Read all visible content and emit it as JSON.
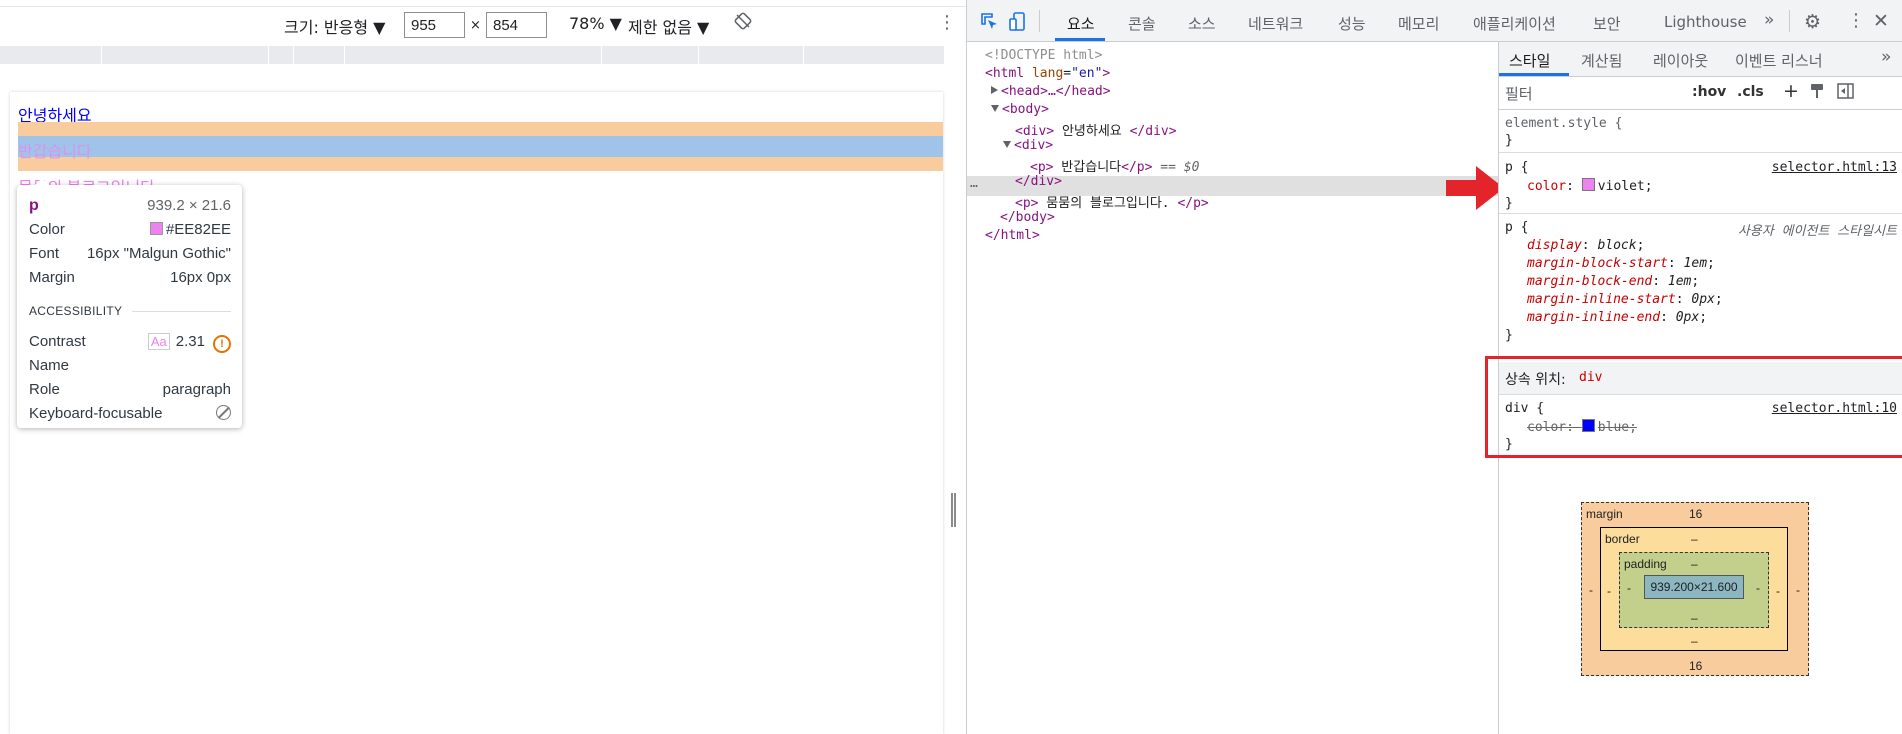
{
  "device_toolbar": {
    "dimensions_label": "크기: 반응형 ▼",
    "width": "955",
    "times": "×",
    "height": "854",
    "zoom": "78% ▼",
    "throttle": "제한 없음 ▼",
    "rotate_icon": "rotate-icon",
    "more_icon": "more-vert-icon"
  },
  "page": {
    "line1": "안녕하세요",
    "line2": "반갑습니다",
    "line3": "뭄뭄의 블로그입니다"
  },
  "tooltip": {
    "tag": "p",
    "size": "939.2 × 21.6",
    "color_label": "Color",
    "color_value": "#EE82EE",
    "font_label": "Font",
    "font_value": "16px \"Malgun Gothic\"",
    "margin_label": "Margin",
    "margin_value": "16px 0px",
    "accessibility_title": "ACCESSIBILITY",
    "contrast_label": "Contrast",
    "contrast_aa": "Aa",
    "contrast_value": "2.31",
    "name_label": "Name",
    "role_label": "Role",
    "role_value": "paragraph",
    "keyboard_label": "Keyboard-focusable"
  },
  "devtools_tabs": [
    "요소",
    "콘솔",
    "소스",
    "네트워크",
    "성능",
    "메모리",
    "애플리케이션",
    "보안",
    "Lighthouse"
  ],
  "devtools_more": "»",
  "dom": {
    "doctype": "<!DOCTYPE html>",
    "html_open_tag": "<html",
    "html_attr": "lang",
    "html_attr_value": "\"en\"",
    "html_open_end": ">",
    "head": "<head>…</head>",
    "body_open": "<body>",
    "div1_open": "<div>",
    "div1_text": " 안녕하세요 ",
    "div1_close": "</div>",
    "div2_open": "<div>",
    "p_open": "<p>",
    "p_text": " 반갑습니다",
    "p_close": "</p>",
    "p_eq": " == $0",
    "div2_close": "</div>",
    "p2_open": "<p>",
    "p2_text": " 뭄뭄의 블로그입니다. ",
    "p2_close": "</p>",
    "body_close": "</body>",
    "html_close": "</html>",
    "dots": "…"
  },
  "styles_pane": {
    "tabs": [
      "스타일",
      "계산됨",
      "레이아웃",
      "이벤트 리스너"
    ],
    "more": "»",
    "filter_placeholder": "필터",
    "hov": ":hov",
    "cls": ".cls",
    "plus": "+",
    "element_style_open": "element.style {",
    "close_brace": "}",
    "p_rule_selector": "p {",
    "p_rule_source": "selector.html:13",
    "p_rule_prop": "color",
    "p_rule_value": "violet",
    "ua_selector": "p {",
    "ua_source": "사용자 에이전트 스타일시트",
    "ua_props": [
      {
        "name": "display",
        "value": "block"
      },
      {
        "name": "margin-block-start",
        "value": "1em"
      },
      {
        "name": "margin-block-end",
        "value": "1em"
      },
      {
        "name": "margin-inline-start",
        "value": "0px"
      },
      {
        "name": "margin-inline-end",
        "value": "0px"
      }
    ],
    "inherit_label": "상속 위치:",
    "inherit_from": "div",
    "div_rule_selector": "div {",
    "div_rule_source": "selector.html:10",
    "div_rule_prop": "color",
    "div_rule_value": "blue"
  },
  "box_model": {
    "margin_label": "margin",
    "margin_top": "16",
    "margin_bottom": "16",
    "margin_left": "-",
    "margin_right": "-",
    "border_label": "border",
    "border_top": "–",
    "border_bottom": "–",
    "border_left": "-",
    "border_right": "-",
    "padding_label": "padding",
    "padding_top": "–",
    "padding_bottom": "–",
    "padding_left": "-",
    "padding_right": "-",
    "content": "939.200×21.600"
  },
  "colors": {
    "violet": "#EE82EE",
    "blue": "#0000FF",
    "highlight_red": "#E3242B"
  }
}
